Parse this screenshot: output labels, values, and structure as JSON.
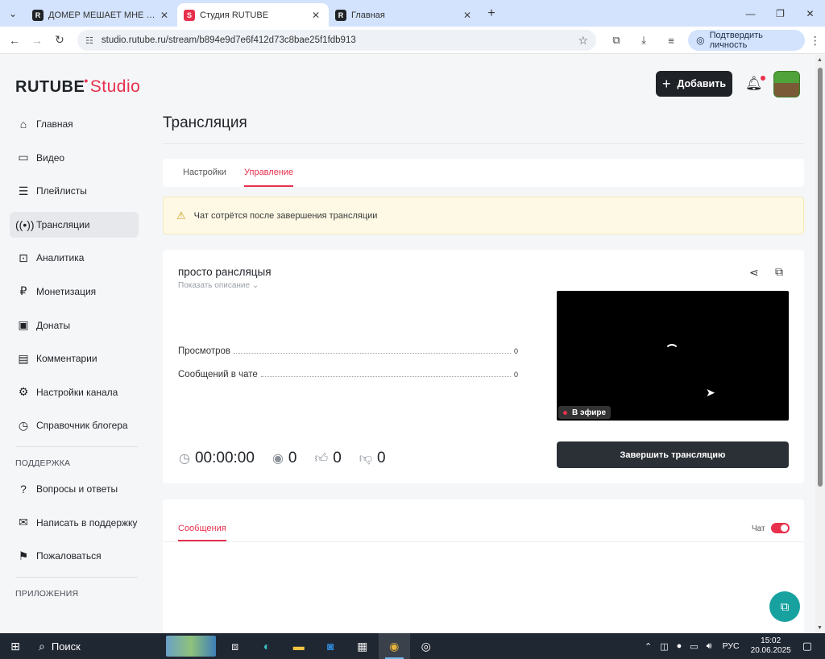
{
  "browser": {
    "tabs": [
      {
        "title": "ДОМЕР МЕШАЕТ МНЕ СТРИМ",
        "favicon": "R"
      },
      {
        "title": "Студия RUTUBE",
        "favicon": "S"
      },
      {
        "title": "Главная",
        "favicon": "R"
      }
    ],
    "url": "studio.rutube.ru/stream/b894e9d7e6f412d73c8bae25f1fdb913",
    "verify_label": "Подтвердить личность"
  },
  "header": {
    "logo_main": "RUTUBE",
    "logo_studio": "Studio",
    "add_label": "Добавить"
  },
  "sidebar": {
    "items": [
      {
        "label": "Главная",
        "icon": "home-icon"
      },
      {
        "label": "Видео",
        "icon": "video-icon"
      },
      {
        "label": "Плейлисты",
        "icon": "playlist-icon"
      },
      {
        "label": "Трансляции",
        "icon": "broadcast-icon"
      },
      {
        "label": "Аналитика",
        "icon": "analytics-icon"
      },
      {
        "label": "Монетизация",
        "icon": "monetization-icon"
      },
      {
        "label": "Донаты",
        "icon": "wallet-icon"
      },
      {
        "label": "Комментарии",
        "icon": "comments-icon"
      },
      {
        "label": "Настройки канала",
        "icon": "settings-icon"
      },
      {
        "label": "Справочник блогера",
        "icon": "book-icon"
      }
    ],
    "support_heading": "ПОДДЕРЖКА",
    "support_items": [
      {
        "label": "Вопросы и ответы",
        "icon": "question-icon"
      },
      {
        "label": "Написать в поддержку",
        "icon": "mail-icon"
      },
      {
        "label": "Пожаловаться",
        "icon": "flag-icon"
      }
    ],
    "apps_heading": "ПРИЛОЖЕНИЯ"
  },
  "main": {
    "title": "Трансляция",
    "tabs": [
      {
        "label": "Настройки"
      },
      {
        "label": "Управление"
      }
    ],
    "warning": "Чат сотрётся после завершения трансляции",
    "stream": {
      "title": "просто рансляцыя",
      "show_description": "Показать описание",
      "stats": [
        {
          "label": "Просмотров",
          "value": "0"
        },
        {
          "label": "Сообщений в чате",
          "value": "0"
        }
      ],
      "duration": "00:00:00",
      "viewers": "0",
      "likes": "0",
      "dislikes": "0",
      "live_label": "В эфире",
      "end_button": "Завершить трансляцию"
    },
    "messages": {
      "tab_label": "Сообщения",
      "chat_label": "Чат",
      "chat_enabled": true
    }
  },
  "taskbar": {
    "search_label": "Поиск",
    "lang": "РУС",
    "time": "15:02",
    "date": "20.06.2025"
  },
  "colors": {
    "accent": "#e8304d",
    "dark": "#1f2328",
    "warning_bg": "#fef9e5",
    "help_fab": "#17a2a0"
  }
}
